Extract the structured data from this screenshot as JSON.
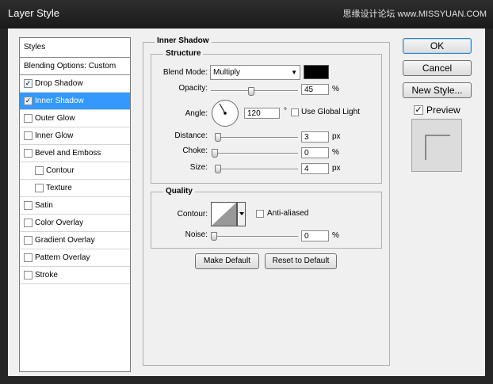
{
  "window": {
    "title": "Layer Style",
    "watermark": "思缘设计论坛 www.MISSYUAN.COM"
  },
  "styles_list": {
    "header": "Styles",
    "blending": "Blending Options: Custom",
    "items": [
      {
        "label": "Drop Shadow",
        "checked": true,
        "indent": false,
        "selected": false
      },
      {
        "label": "Inner Shadow",
        "checked": true,
        "indent": false,
        "selected": true
      },
      {
        "label": "Outer Glow",
        "checked": false,
        "indent": false,
        "selected": false
      },
      {
        "label": "Inner Glow",
        "checked": false,
        "indent": false,
        "selected": false
      },
      {
        "label": "Bevel and Emboss",
        "checked": false,
        "indent": false,
        "selected": false
      },
      {
        "label": "Contour",
        "checked": false,
        "indent": true,
        "selected": false
      },
      {
        "label": "Texture",
        "checked": false,
        "indent": true,
        "selected": false
      },
      {
        "label": "Satin",
        "checked": false,
        "indent": false,
        "selected": false
      },
      {
        "label": "Color Overlay",
        "checked": false,
        "indent": false,
        "selected": false
      },
      {
        "label": "Gradient Overlay",
        "checked": false,
        "indent": false,
        "selected": false
      },
      {
        "label": "Pattern Overlay",
        "checked": false,
        "indent": false,
        "selected": false
      },
      {
        "label": "Stroke",
        "checked": false,
        "indent": false,
        "selected": false
      }
    ]
  },
  "inner_shadow": {
    "title": "Inner Shadow",
    "structure_title": "Structure",
    "blend_mode_label": "Blend Mode:",
    "blend_mode_value": "Multiply",
    "color_swatch": "#000000",
    "opacity_label": "Opacity:",
    "opacity_value": "45",
    "opacity_unit": "%",
    "opacity_level": 45,
    "angle_label": "Angle:",
    "angle_value": "120",
    "angle_unit": "°",
    "angle_degrees": 120,
    "use_global_light_label": "Use Global Light",
    "use_global_light_checked": false,
    "distance_label": "Distance:",
    "distance_value": "3",
    "distance_unit": "px",
    "choke_label": "Choke:",
    "choke_value": "0",
    "choke_unit": "%",
    "size_label": "Size:",
    "size_value": "4",
    "size_unit": "px",
    "quality_title": "Quality",
    "contour_label": "Contour:",
    "anti_aliased_label": "Anti-aliased",
    "noise_label": "Noise:",
    "noise_value": "0",
    "noise_unit": "%",
    "make_default_label": "Make Default",
    "reset_default_label": "Reset to Default"
  },
  "buttons": {
    "ok": "OK",
    "cancel": "Cancel",
    "new_style": "New Style...",
    "preview_label": "Preview",
    "preview_checked": true
  },
  "colors": {
    "selection": "#3399ff",
    "dialog_bg": "#f0f0f0",
    "title_bar": "#1f1f1f"
  }
}
